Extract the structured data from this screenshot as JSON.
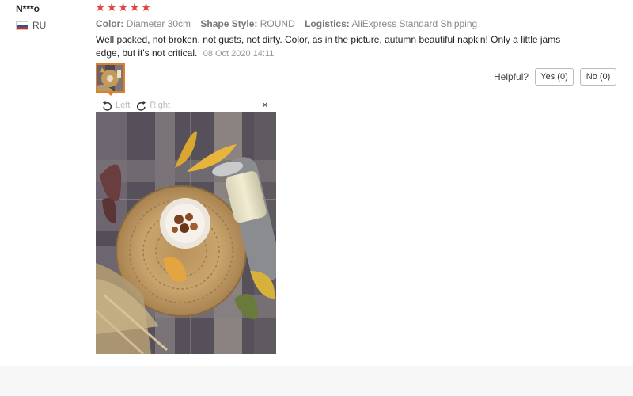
{
  "review": {
    "reviewer": "N***o",
    "country": "RU",
    "rating": 5,
    "attributes": [
      {
        "key": "Color:",
        "value": "Diameter 30cm"
      },
      {
        "key": "Shape Style:",
        "value": "ROUND"
      },
      {
        "key": "Logistics:",
        "value": "AliExpress Standard Shipping"
      }
    ],
    "text": "Well packed, not broken, not gusts, not dirty. Color, as in the picture, autumn beautiful napkin! Only a little jams edge, but it's not critical.",
    "date": "08 Oct 2020 14:11"
  },
  "helpful": {
    "label": "Helpful?",
    "yes": "Yes (0)",
    "no": "No (0)"
  },
  "viewer": {
    "left": "Left",
    "right": "Right",
    "close": "×"
  },
  "colors": {
    "star": "#e64545",
    "thumb_border": "#e07f2a"
  }
}
